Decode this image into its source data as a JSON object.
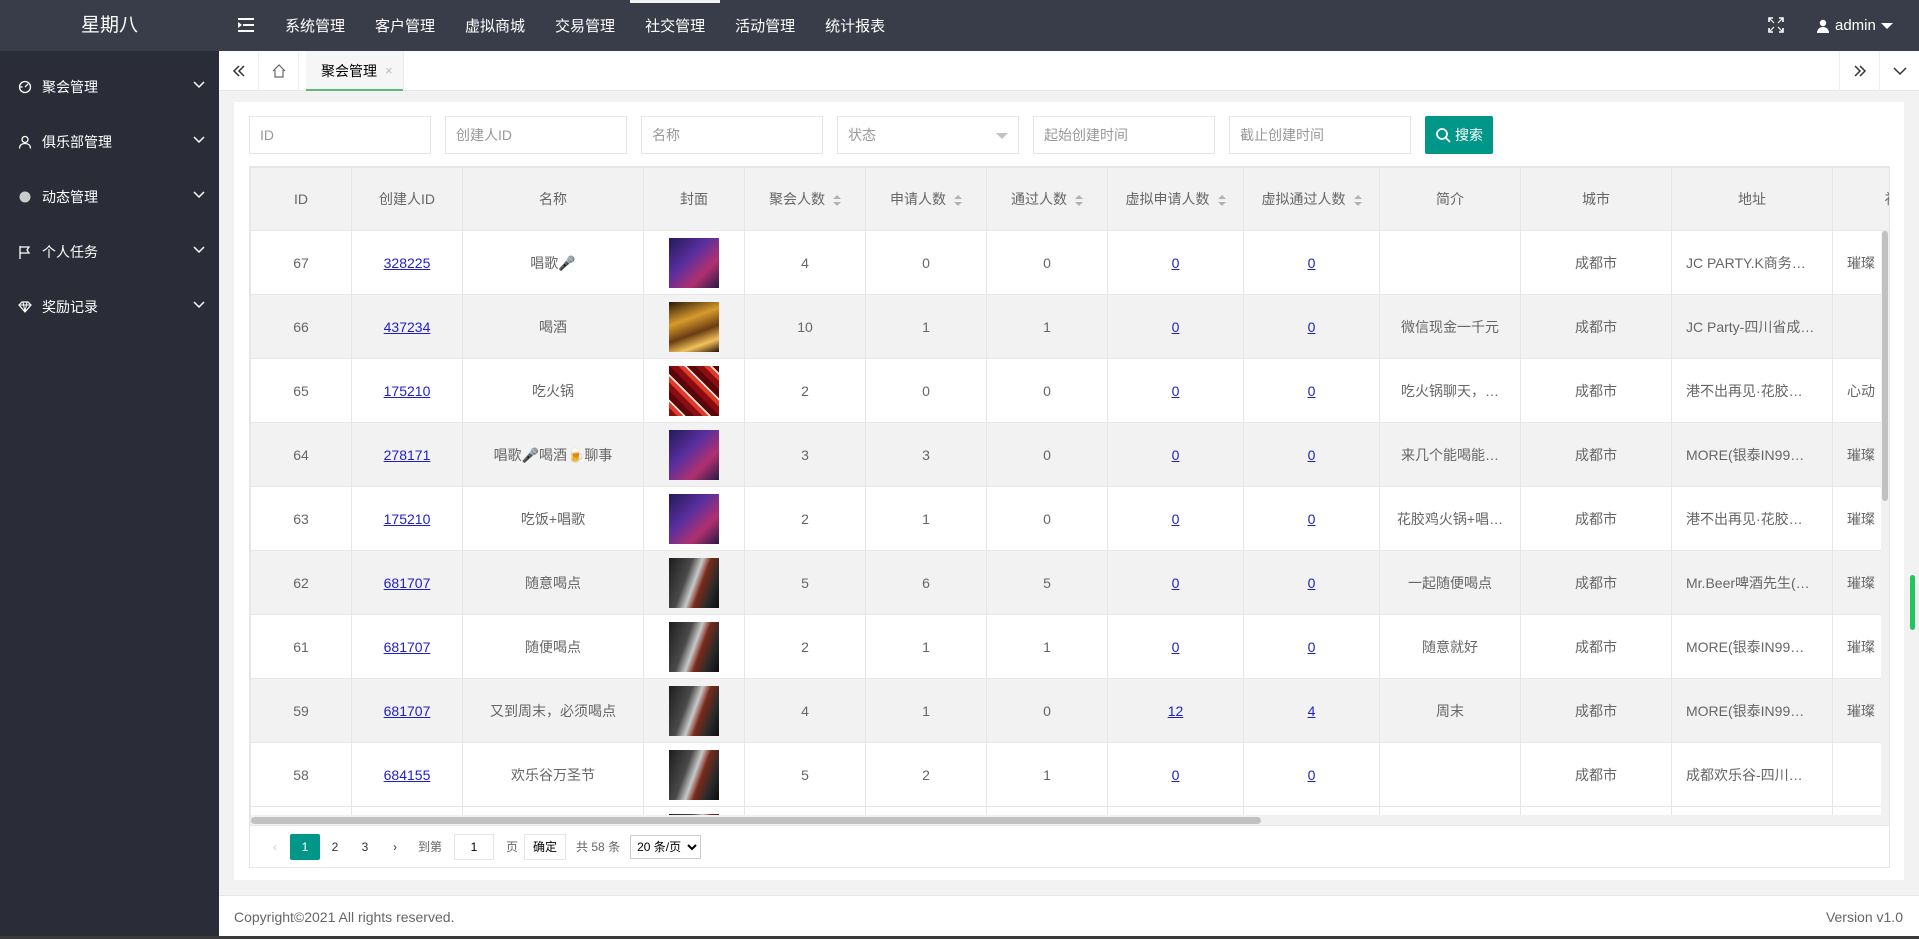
{
  "header": {
    "logo": "星期八",
    "nav": [
      "系统管理",
      "客户管理",
      "虚拟商城",
      "交易管理",
      "社交管理",
      "活动管理",
      "统计报表"
    ],
    "active_nav": 4,
    "user": "admin"
  },
  "sidebar": {
    "items": [
      {
        "label": "聚会管理",
        "icon": "gauge-icon"
      },
      {
        "label": "俱乐部管理",
        "icon": "user-icon"
      },
      {
        "label": "动态管理",
        "icon": "circle-icon"
      },
      {
        "label": "个人任务",
        "icon": "flag-icon"
      },
      {
        "label": "奖励记录",
        "icon": "diamond-icon"
      }
    ]
  },
  "tabs": {
    "active_label": "聚会管理",
    "close_glyph": "×"
  },
  "filters": {
    "id_placeholder": "ID",
    "creator_placeholder": "创建人ID",
    "name_placeholder": "名称",
    "status_placeholder": "状态",
    "start_placeholder": "起始创建时间",
    "end_placeholder": "截止创建时间",
    "search_label": "搜索"
  },
  "table": {
    "columns": [
      "ID",
      "创建人ID",
      "名称",
      "封面",
      "聚会人数",
      "申请人数",
      "通过人数",
      "虚拟申请人数",
      "虚拟通过人数",
      "简介",
      "城市",
      "地址",
      "礼"
    ],
    "rows": [
      {
        "id": "67",
        "creator": "328225",
        "name": "唱歌🎤",
        "cover": "singer",
        "party": "4",
        "apply": "0",
        "pass": "0",
        "vapply": "0",
        "vpass": "0",
        "intro": "",
        "city": "成都市",
        "addr": "JC PARTY.K商务…",
        "gift": "璀璨"
      },
      {
        "id": "66",
        "creator": "437234",
        "name": "喝酒",
        "cover": "bar",
        "party": "10",
        "apply": "1",
        "pass": "1",
        "vapply": "0",
        "vpass": "0",
        "intro": "微信现金一千元",
        "city": "成都市",
        "addr": "JC Party-四川省成…",
        "gift": ""
      },
      {
        "id": "65",
        "creator": "175210",
        "name": "吃火锅",
        "cover": "hotpot",
        "party": "2",
        "apply": "0",
        "pass": "0",
        "vapply": "0",
        "vpass": "0",
        "intro": "吃火锅聊天，…",
        "city": "成都市",
        "addr": "港不出再见·花胶…",
        "gift": "心动"
      },
      {
        "id": "64",
        "creator": "278171",
        "name": "唱歌🎤喝酒🍺聊事",
        "cover": "singer",
        "party": "3",
        "apply": "3",
        "pass": "0",
        "vapply": "0",
        "vpass": "0",
        "intro": "来几个能喝能…",
        "city": "成都市",
        "addr": "MORE(银泰IN99…",
        "gift": "璀璨"
      },
      {
        "id": "63",
        "creator": "175210",
        "name": "吃饭+唱歌",
        "cover": "singer",
        "party": "2",
        "apply": "1",
        "pass": "0",
        "vapply": "0",
        "vpass": "0",
        "intro": "花胶鸡火锅+唱…",
        "city": "成都市",
        "addr": "港不出再见·花胶…",
        "gift": "璀璨"
      },
      {
        "id": "62",
        "creator": "681707",
        "name": "随意喝点",
        "cover": "wine",
        "party": "5",
        "apply": "6",
        "pass": "5",
        "vapply": "0",
        "vpass": "0",
        "intro": "一起随便喝点",
        "city": "成都市",
        "addr": "Mr.Beer啤酒先生(…",
        "gift": "璀璨"
      },
      {
        "id": "61",
        "creator": "681707",
        "name": "随便喝点",
        "cover": "wine",
        "party": "2",
        "apply": "1",
        "pass": "1",
        "vapply": "0",
        "vpass": "0",
        "intro": "随意就好",
        "city": "成都市",
        "addr": "MORE(银泰IN99…",
        "gift": "璀璨"
      },
      {
        "id": "59",
        "creator": "681707",
        "name": "又到周末，必须喝点",
        "cover": "wine",
        "party": "4",
        "apply": "1",
        "pass": "0",
        "vapply": "12",
        "vpass": "4",
        "intro": "周末",
        "city": "成都市",
        "addr": "MORE(银泰IN99…",
        "gift": "璀璨"
      },
      {
        "id": "58",
        "creator": "684155",
        "name": "欢乐谷万圣节",
        "cover": "wine",
        "party": "5",
        "apply": "2",
        "pass": "1",
        "vapply": "0",
        "vpass": "0",
        "intro": "",
        "city": "成都市",
        "addr": "成都欢乐谷-四川…",
        "gift": ""
      }
    ]
  },
  "pager": {
    "prev": "‹",
    "pages": [
      "1",
      "2",
      "3"
    ],
    "current": "1",
    "next": "›",
    "goto_label": "到第",
    "goto_value": "1",
    "page_unit": "页",
    "ok_label": "确定",
    "total_text": "共 58 条",
    "limit_option": "20 条/页"
  },
  "footer": {
    "copyright": "Copyright©2021 All rights reserved.",
    "version": "Version v1.0"
  },
  "colors": {
    "header_bg": "#393d49",
    "sidebar_bg": "#2a2d37",
    "accent": "#009688",
    "link": "#1e1ecc"
  }
}
